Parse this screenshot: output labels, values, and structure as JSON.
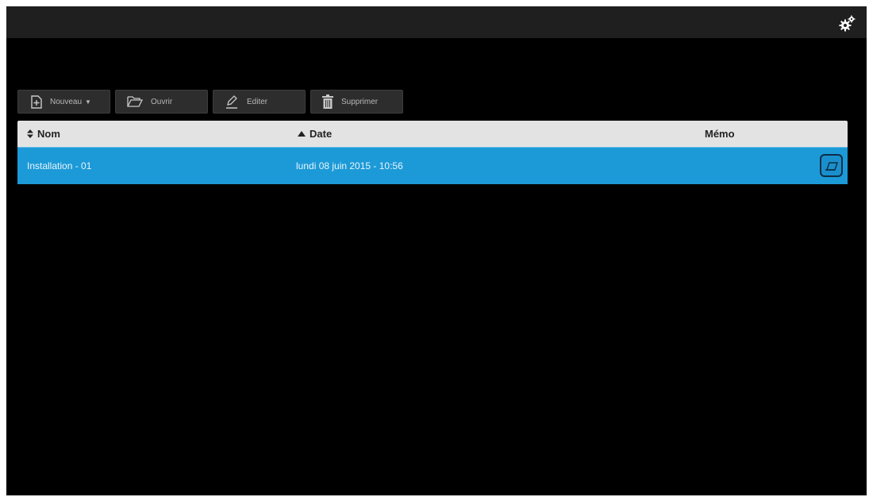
{
  "topbar": {
    "settings_icon": "gears-icon"
  },
  "toolbar": {
    "new_label": "Nouveau",
    "open_label": "Ouvrir",
    "edit_label": "Editer",
    "delete_label": "Supprimer"
  },
  "table": {
    "columns": {
      "nom": "Nom",
      "date": "Date",
      "memo": "Mémo"
    },
    "rows": [
      {
        "nom": "Installation - 01",
        "date": "lundi 08 juin 2015 - 10:56",
        "memo_icon": "memo-edit-icon",
        "selected": true
      }
    ]
  },
  "colors": {
    "selected_row": "#1c9ad8",
    "header_bg": "#e3e3e3",
    "background": "#000000"
  }
}
